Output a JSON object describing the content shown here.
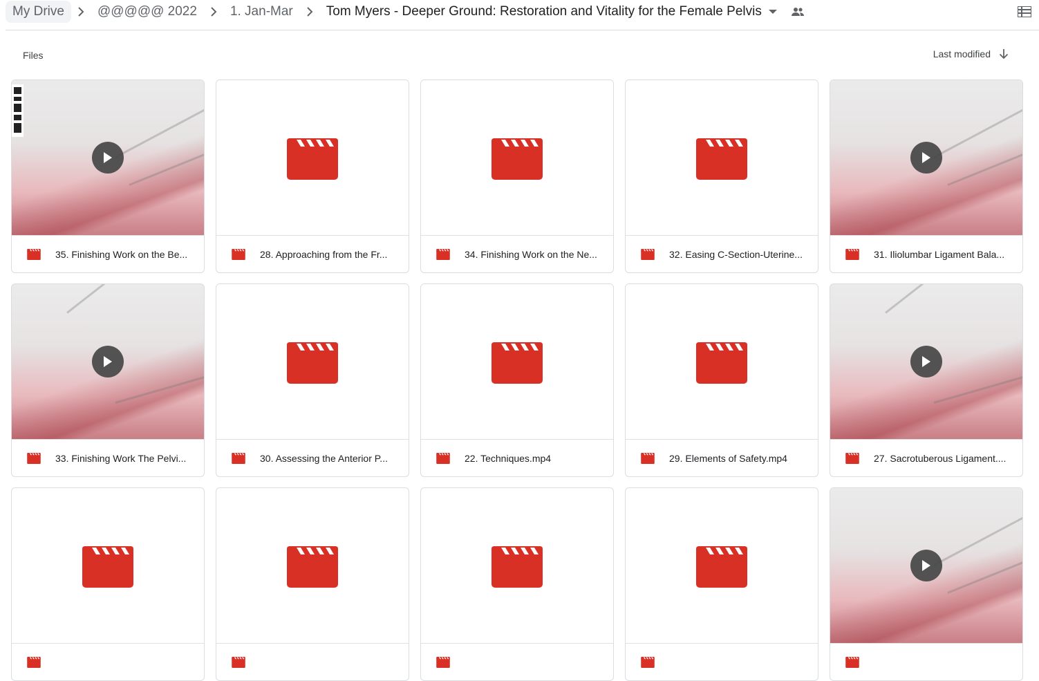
{
  "breadcrumb": {
    "items": [
      "My Drive",
      "@@@@@ 2022",
      "1. Jan-Mar",
      "Tom Myers - Deeper Ground: Restoration and Vitality for the Female Pelvis"
    ]
  },
  "section": {
    "label": "Files"
  },
  "sort": {
    "label": "Last modified"
  },
  "colors": {
    "video_red": "#d93025",
    "text": "#202124",
    "icon_gray": "#5f6368"
  },
  "files": [
    {
      "name": "35. Finishing Work on the Be...",
      "thumb": "photo"
    },
    {
      "name": "28. Approaching from the Fr...",
      "thumb": "icon"
    },
    {
      "name": "34. Finishing Work on the Ne...",
      "thumb": "icon"
    },
    {
      "name": "32. Easing C-Section-Uterine...",
      "thumb": "icon"
    },
    {
      "name": "31. Iliolumbar Ligament Bala...",
      "thumb": "photo"
    },
    {
      "name": "33. Finishing Work The Pelvi...",
      "thumb": "photo"
    },
    {
      "name": "30. Assessing the Anterior P...",
      "thumb": "icon"
    },
    {
      "name": "22. Techniques.mp4",
      "thumb": "icon"
    },
    {
      "name": "29. Elements of Safety.mp4",
      "thumb": "icon"
    },
    {
      "name": "27. Sacrotuberous Ligament....",
      "thumb": "photo"
    },
    {
      "name": "",
      "thumb": "icon"
    },
    {
      "name": "",
      "thumb": "icon"
    },
    {
      "name": "",
      "thumb": "icon"
    },
    {
      "name": "",
      "thumb": "icon"
    },
    {
      "name": "",
      "thumb": "photo"
    }
  ]
}
